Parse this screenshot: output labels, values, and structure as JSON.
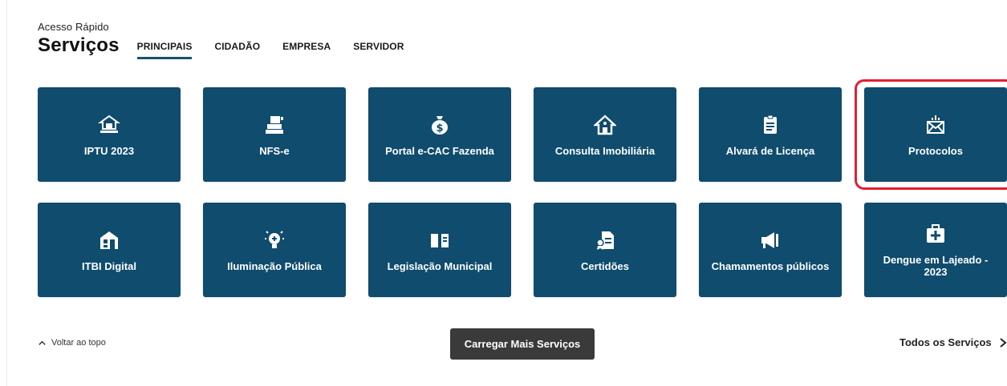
{
  "header": {
    "pretitle": "Acesso Rápido",
    "title": "Serviços",
    "tabs": [
      {
        "label": "PRINCIPAIS",
        "active": true
      },
      {
        "label": "CIDADÃO",
        "active": false
      },
      {
        "label": "EMPRESA",
        "active": false
      },
      {
        "label": "SERVIDOR",
        "active": false
      }
    ]
  },
  "colors": {
    "card_bg": "#0f4c6e",
    "accent": "#1b4f6b",
    "highlight": "#e02030",
    "button_bg": "#3a3a3a"
  },
  "services": [
    {
      "label": "IPTU 2023",
      "icon": "house-document-icon"
    },
    {
      "label": "NFS-e",
      "icon": "invoice-machine-icon"
    },
    {
      "label": "Portal e-CAC Fazenda",
      "icon": "money-bag-icon"
    },
    {
      "label": "Consulta Imobiliária",
      "icon": "home-icon"
    },
    {
      "label": "Alvará de Licença",
      "icon": "clipboard-icon"
    },
    {
      "label": "Protocolos",
      "icon": "envelope-icon"
    },
    {
      "label": "ITBI Digital",
      "icon": "building-transfer-icon"
    },
    {
      "label": "Iluminação Pública",
      "icon": "lightbulb-icon"
    },
    {
      "label": "Legislação Municipal",
      "icon": "book-icon"
    },
    {
      "label": "Certidões",
      "icon": "certificate-icon"
    },
    {
      "label": "Chamamentos públicos",
      "icon": "megaphone-icon"
    },
    {
      "label": "Dengue em Lajeado - 2023",
      "icon": "medical-kit-icon"
    }
  ],
  "footer": {
    "back_to_top": "Voltar ao topo",
    "load_more": "Carregar Mais Serviços",
    "all_services": "Todos os Serviços"
  }
}
